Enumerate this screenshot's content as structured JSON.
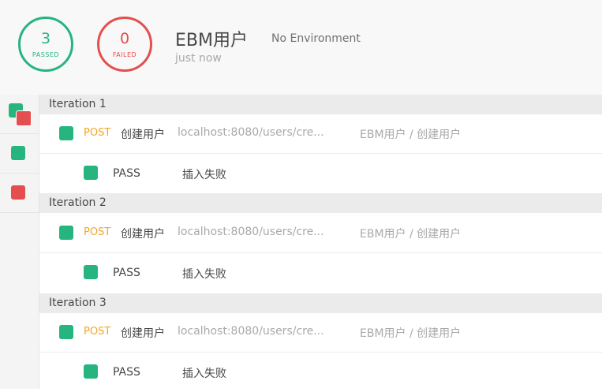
{
  "summary": {
    "passed_count": "3",
    "passed_label": "PASSED",
    "failed_count": "0",
    "failed_label": "FAILED",
    "collection_name": "EBM用户",
    "environment": "No Environment",
    "time": "just now"
  },
  "colors": {
    "pass": "#26b47f",
    "fail": "#e44e4e",
    "method": "#f5a623"
  },
  "sidebar": {
    "items": [
      {
        "icon": "all-results-icon"
      },
      {
        "icon": "passed-filter-icon"
      },
      {
        "icon": "failed-filter-icon"
      }
    ]
  },
  "iterations": [
    {
      "label": "Iteration 1",
      "request": {
        "method": "POST",
        "name": "创建用户",
        "url": "localhost:8080/users/cre...",
        "path": "EBM用户 / 创建用户"
      },
      "test": {
        "status": "PASS",
        "name": "插入失败"
      }
    },
    {
      "label": "Iteration 2",
      "request": {
        "method": "POST",
        "name": "创建用户",
        "url": "localhost:8080/users/cre...",
        "path": "EBM用户 / 创建用户"
      },
      "test": {
        "status": "PASS",
        "name": "插入失败"
      }
    },
    {
      "label": "Iteration 3",
      "request": {
        "method": "POST",
        "name": "创建用户",
        "url": "localhost:8080/users/cre...",
        "path": "EBM用户 / 创建用户"
      },
      "test": {
        "status": "PASS",
        "name": "插入失败"
      }
    }
  ]
}
